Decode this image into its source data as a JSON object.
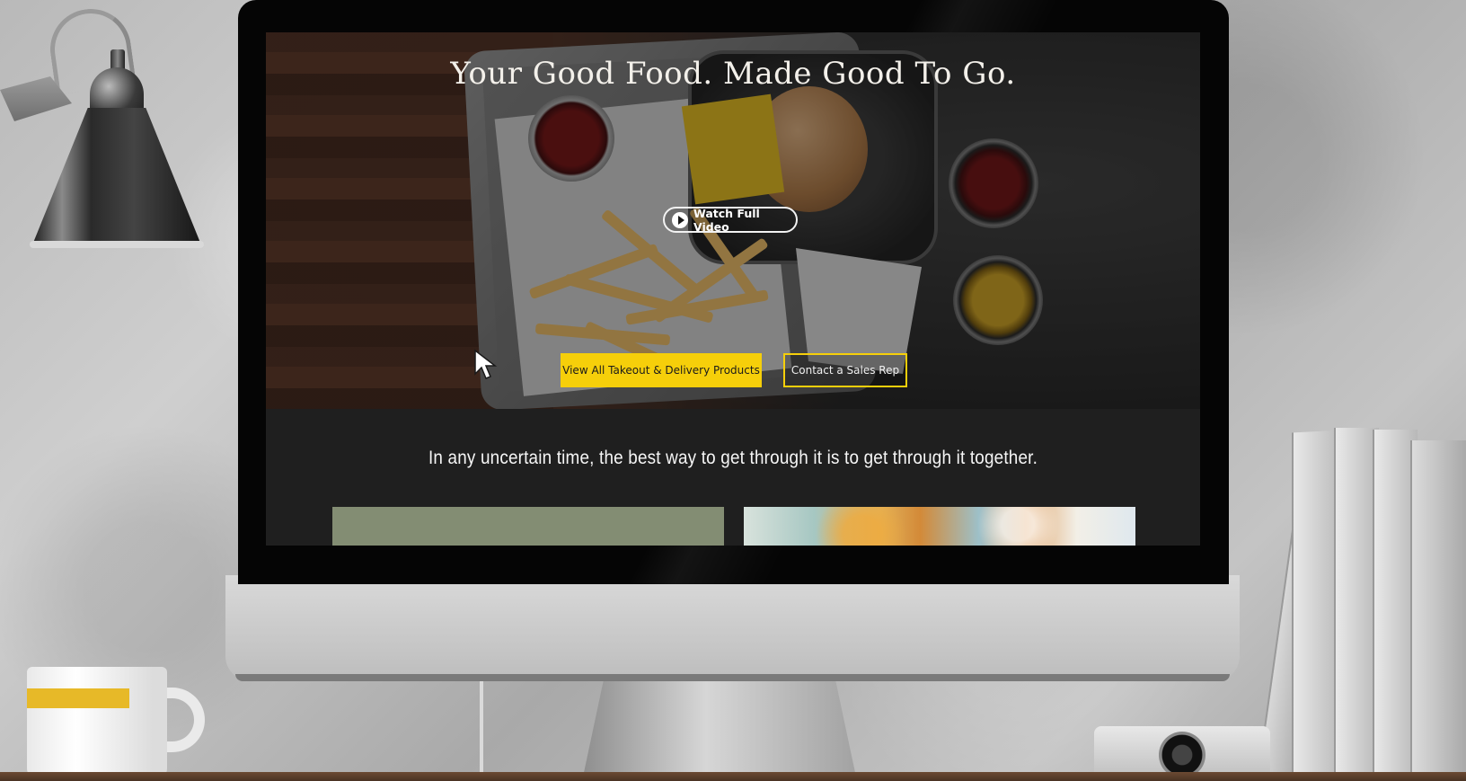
{
  "hero": {
    "title": "Your Good Food. Made Good To Go.",
    "watch_video_label": "Watch Full Video",
    "primary_cta_label": "View All Takeout & Delivery Products",
    "secondary_cta_label": "Contact a Sales Rep"
  },
  "intro": {
    "tagline": "In any uncertain time, the best way to get through it is to get through it together."
  },
  "colors": {
    "accent_yellow": "#f6cf0a",
    "section_dark": "#1f1f1f",
    "card_green": "#838d73"
  },
  "icons": {
    "play": "play-icon",
    "cursor": "mouse-cursor-icon"
  }
}
